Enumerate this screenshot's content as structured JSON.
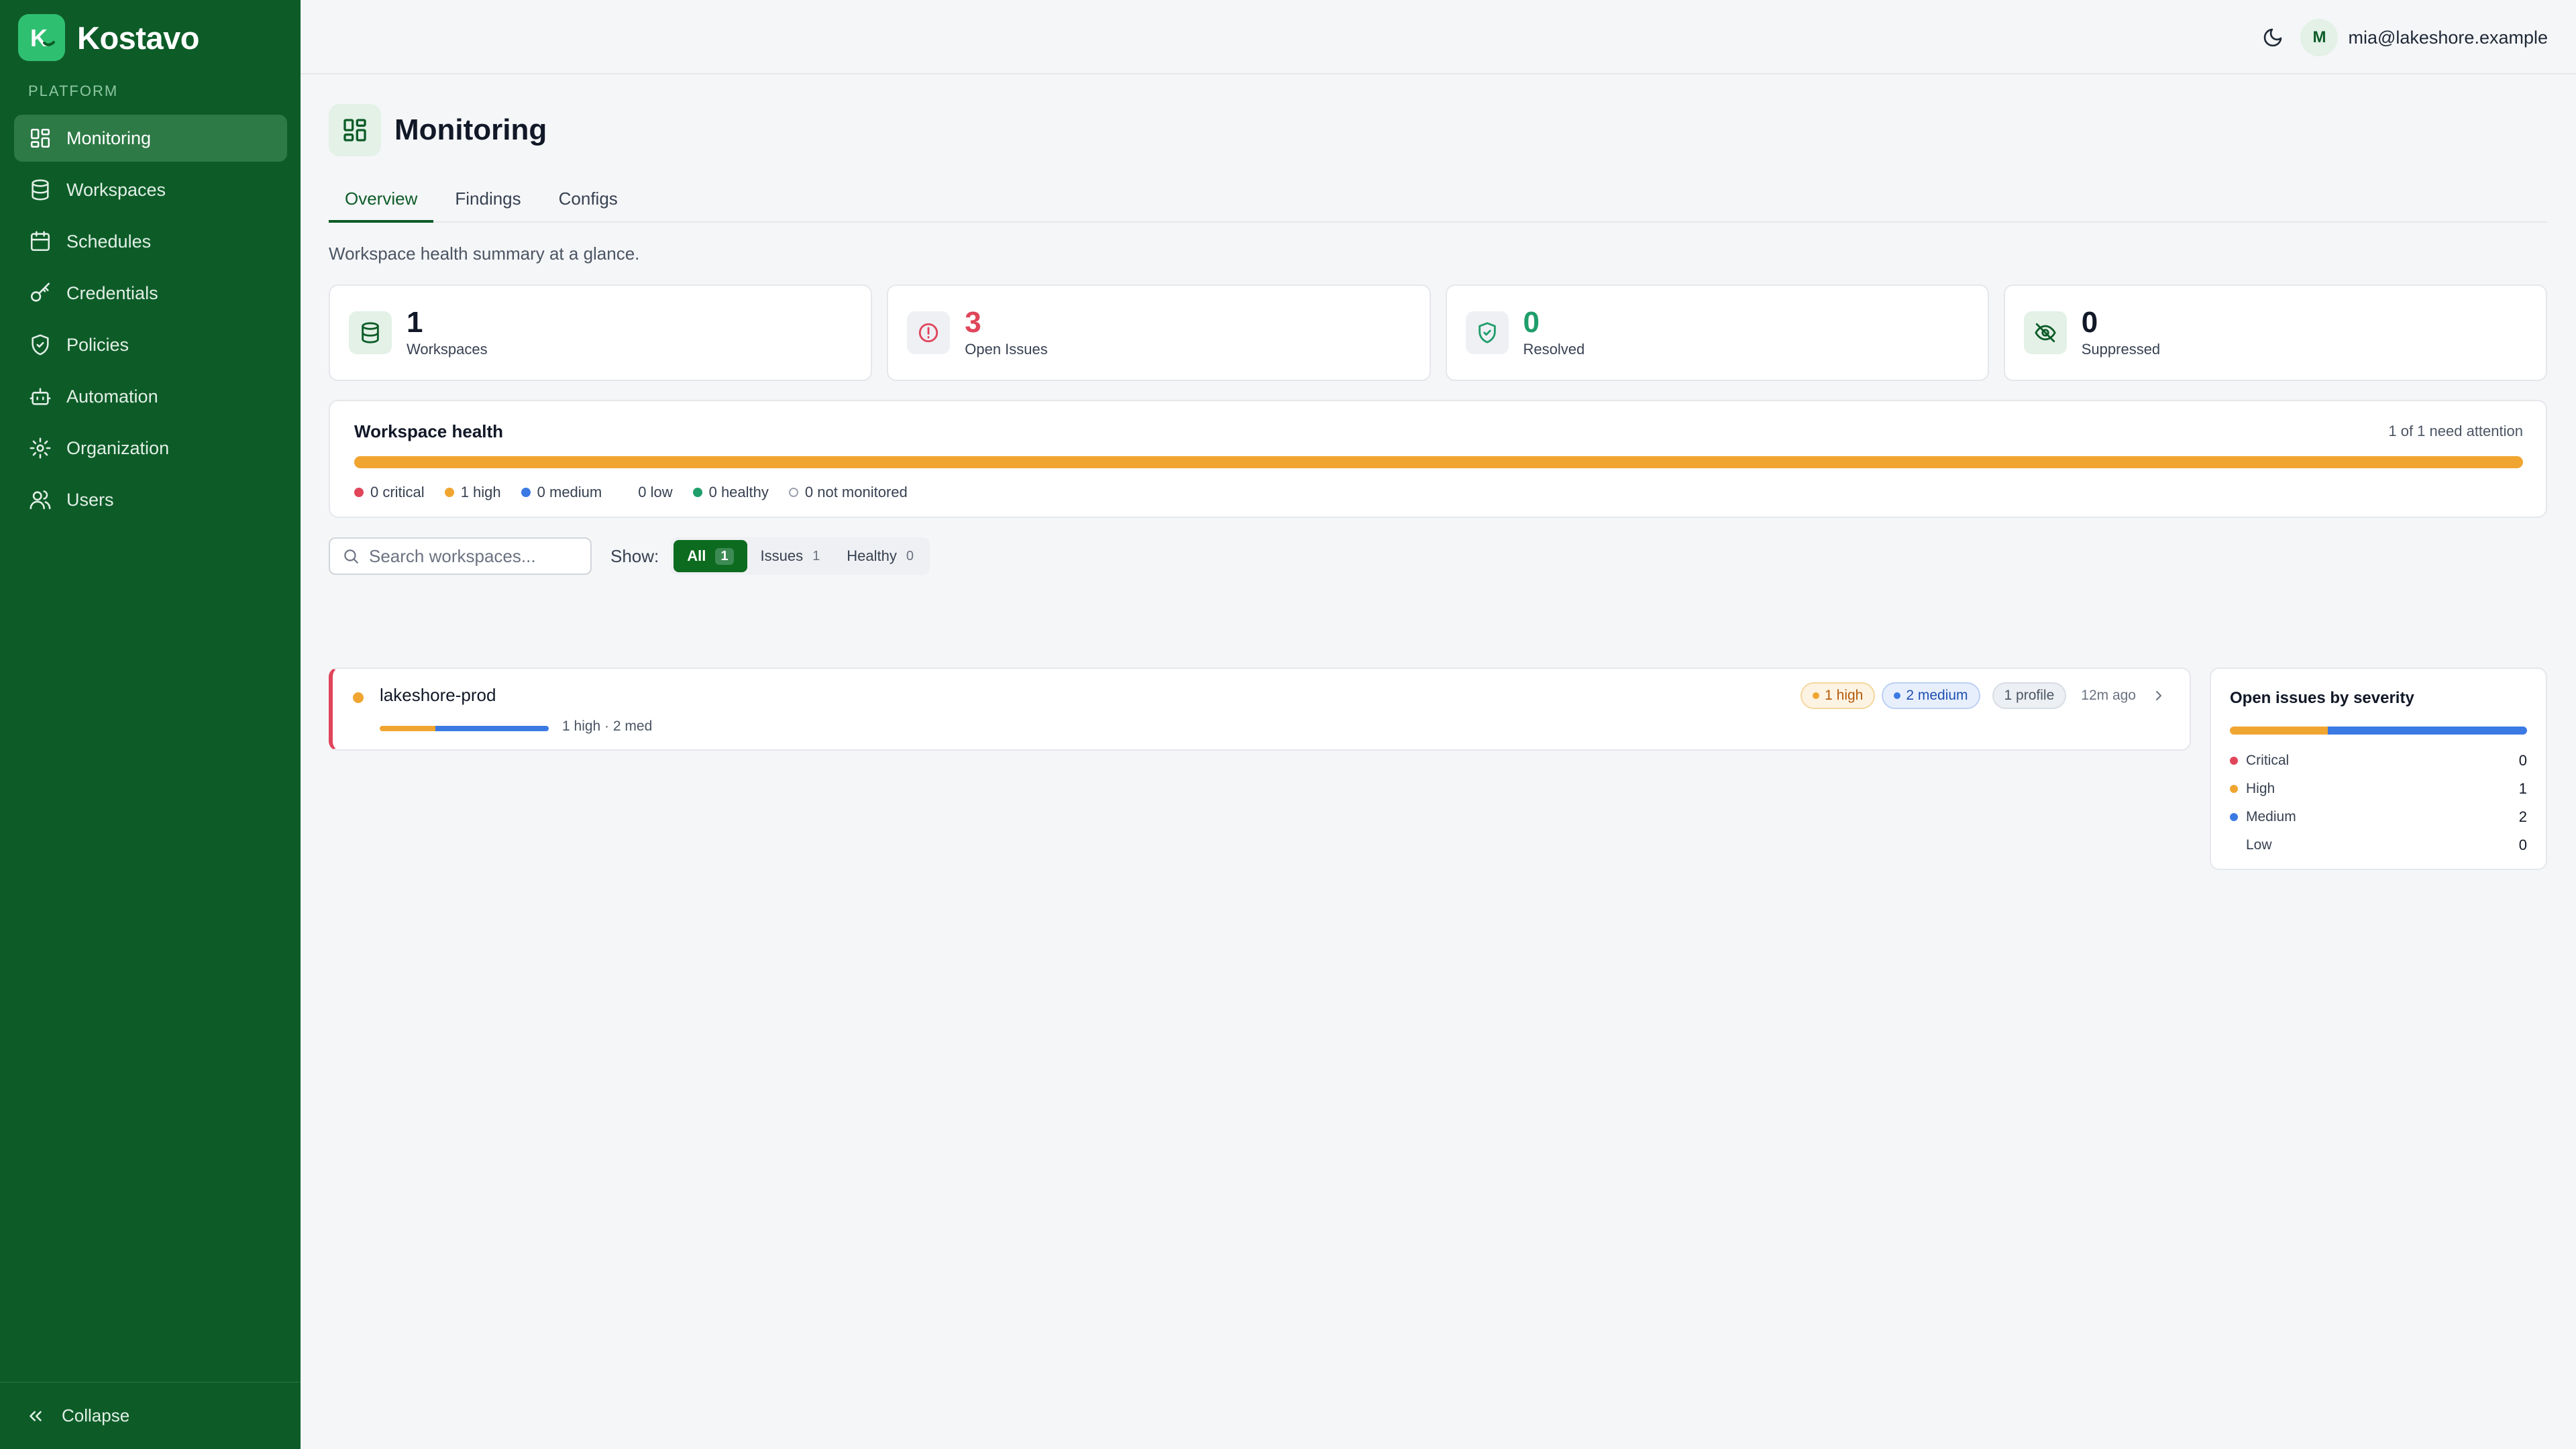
{
  "brand": {
    "initial": "K",
    "name": "Kostavo"
  },
  "sidebar": {
    "section_label": "PLATFORM",
    "items": [
      {
        "label": "Monitoring",
        "icon": "dashboard-icon",
        "active": true
      },
      {
        "label": "Workspaces",
        "icon": "database-icon"
      },
      {
        "label": "Schedules",
        "icon": "calendar-icon"
      },
      {
        "label": "Credentials",
        "icon": "key-icon"
      },
      {
        "label": "Policies",
        "icon": "shield-icon"
      },
      {
        "label": "Automation",
        "icon": "bot-icon"
      },
      {
        "label": "Organization",
        "icon": "gear-icon"
      },
      {
        "label": "Users",
        "icon": "users-icon"
      }
    ],
    "collapse_label": "Collapse"
  },
  "topbar": {
    "avatar_initial": "M",
    "user_email": "mia@lakeshore.example"
  },
  "page": {
    "title": "Monitoring",
    "tabs": [
      {
        "label": "Overview",
        "active": true
      },
      {
        "label": "Findings"
      },
      {
        "label": "Configs"
      }
    ],
    "subtitle": "Workspace health summary at a glance."
  },
  "stats": [
    {
      "value": "1",
      "label": "Workspaces",
      "color": "#111827",
      "icon": "database-icon"
    },
    {
      "value": "3",
      "label": "Open Issues",
      "color": "#e0455a",
      "icon": "alert-circle-icon"
    },
    {
      "value": "0",
      "label": "Resolved",
      "color": "#1f9d6b",
      "icon": "shield-check-icon"
    },
    {
      "value": "0",
      "label": "Suppressed",
      "color": "#111827",
      "icon": "eye-off-icon"
    }
  ],
  "health": {
    "title": "Workspace health",
    "note": "1 of 1 need attention",
    "legend": [
      {
        "label": "0 critical",
        "color": "#e0455a"
      },
      {
        "label": "1 high",
        "color": "#f1a531"
      },
      {
        "label": "0 medium",
        "color": "#3b7ae3"
      },
      {
        "label": "0 low",
        "color": "none"
      },
      {
        "label": "0 healthy",
        "color": "#1f9d6b"
      },
      {
        "label": "0 not monitored",
        "color": "outline"
      }
    ]
  },
  "filters": {
    "search_placeholder": "Search workspaces...",
    "show_label": "Show:",
    "options": [
      {
        "label": "All",
        "count": "1",
        "active": true
      },
      {
        "label": "Issues",
        "count": "1"
      },
      {
        "label": "Healthy",
        "count": "0"
      }
    ]
  },
  "workspaces": [
    {
      "name": "lakeshore-prod",
      "summary": "1 high · 2 med",
      "high_pill": "1 high",
      "medium_pill": "2 medium",
      "profile_pill": "1 profile",
      "time": "12m ago"
    }
  ],
  "severity": {
    "title": "Open issues by severity",
    "rows": [
      {
        "label": "Critical",
        "count": "0",
        "color": "#e0455a"
      },
      {
        "label": "High",
        "count": "1",
        "color": "#f1a531"
      },
      {
        "label": "Medium",
        "count": "2",
        "color": "#3b7ae3"
      },
      {
        "label": "Low",
        "count": "0",
        "color": "none"
      }
    ]
  },
  "colors": {
    "sidebar_bg": "#0d5c28",
    "accent": "#0d6b1f",
    "high": "#f1a531",
    "medium": "#3b7ae3",
    "critical": "#e0455a"
  }
}
